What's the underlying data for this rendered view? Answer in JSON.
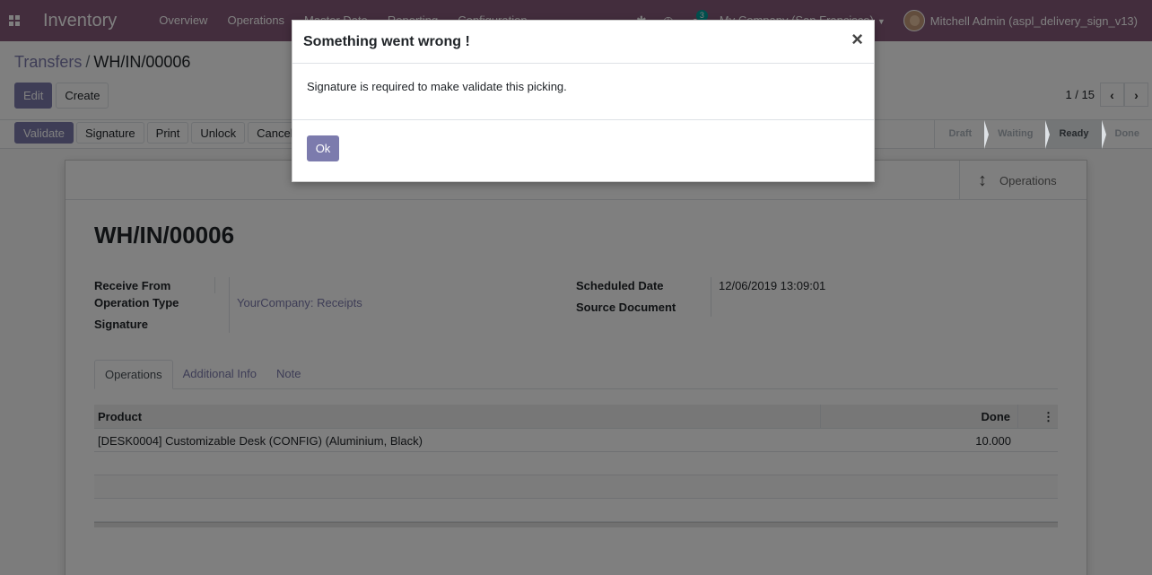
{
  "navbar": {
    "app_title": "Inventory",
    "menu": [
      "Overview",
      "Operations",
      "Master Data",
      "Reporting",
      "Configuration"
    ],
    "chat_badge": "3",
    "company": "My Company (San Francisco)",
    "user": "Mitchell Admin (aspl_delivery_sign_v13)"
  },
  "breadcrumb": {
    "parent": "Transfers",
    "current": "WH/IN/00006"
  },
  "control": {
    "edit_label": "Edit",
    "create_label": "Create",
    "pager_value": "1 / 15"
  },
  "statusbar": {
    "buttons": [
      "Validate",
      "Signature",
      "Print",
      "Unlock",
      "Cancel"
    ],
    "stages": [
      "Draft",
      "Waiting",
      "Ready",
      "Done"
    ],
    "active_stage": "Ready"
  },
  "form": {
    "smart_button": "Operations",
    "title": "WH/IN/00006",
    "labels": {
      "receive_from": "Receive From",
      "operation_type": "Operation Type",
      "signature": "Signature",
      "scheduled_date": "Scheduled Date",
      "source_document": "Source Document"
    },
    "values": {
      "operation_type": "YourCompany: Receipts",
      "scheduled_date": "12/06/2019 13:09:01"
    },
    "tabs": [
      "Operations",
      "Additional Info",
      "Note"
    ],
    "table": {
      "headers": [
        "Product",
        "Done"
      ],
      "rows": [
        {
          "product": "[DESK0004] Customizable Desk (CONFIG) (Aluminium, Black)",
          "done": "10.000"
        }
      ]
    }
  },
  "modal": {
    "title": "Something went wrong !",
    "message": "Signature is required to make validate this picking.",
    "ok_label": "Ok",
    "close_glyph": "×"
  }
}
